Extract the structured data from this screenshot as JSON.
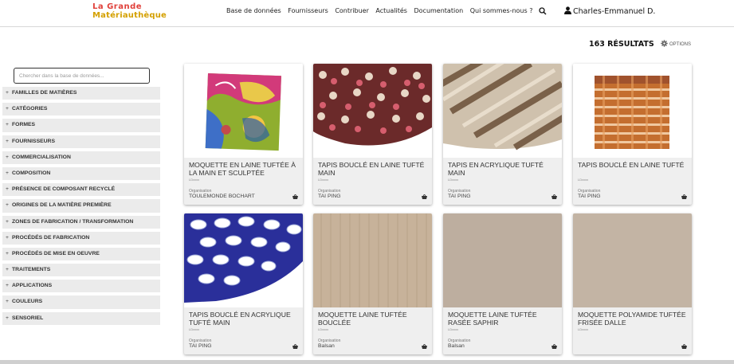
{
  "header": {
    "logo_line1": "La Grande",
    "logo_line2": "Matériauthèque",
    "nav": [
      "Base de données",
      "Fournisseurs",
      "Contribuer",
      "Actualités",
      "Documentation",
      "Qui sommes-nous ?"
    ],
    "user": "Charles-Emmanuel D."
  },
  "results": {
    "count_label": "163 RÉSULTATS",
    "options_label": "OPTIONS"
  },
  "sidebar": {
    "search_placeholder": "Chercher dans la base de données...",
    "filters": [
      "FAMILLES DE MATIÈRES",
      "CATÉGORIES",
      "FORMES",
      "FOURNISSEURS",
      "COMMERCIALISATION",
      "COMPOSITION",
      "PRÉSENCE DE COMPOSANT RECYCLÉ",
      "ORIGINES DE LA MATIÈRE PREMIÈRE",
      "ZONES DE FABRICATION / TRANSFORMATION",
      "PROCÉDÉS DE FABRICATION",
      "PROCÉDÉS DE MISE EN OEUVRE",
      "TRAITEMENTS",
      "APPLICATIONS",
      "COULEURS",
      "SENSORIEL"
    ]
  },
  "cards": [
    {
      "title": "MOQUETTE EN LAINE TUFTÉE À LA MAIN ET SCULPTÉE",
      "ref": "LDxxxx",
      "org_label": "Organisation",
      "org": "TOULEMONDE BOCHART",
      "image": "colorful-hand-tufted-rug"
    },
    {
      "title": "TAPIS BOUCLÉ EN LAINE TUFTÉ MAIN",
      "ref": "LDxxxx",
      "org_label": "Organisation",
      "org": "TAI PING",
      "image": "multicolor-loop-wool-carpet"
    },
    {
      "title": "TAPIS EN ACRYLIQUE TUFTÉ MAIN",
      "ref": "LDxxxx",
      "org_label": "Organisation",
      "org": "TAI PING",
      "image": "beige-brown-acrylic-carpet"
    },
    {
      "title": "TAPIS BOUCLÉ EN LAINE TUFTÉ",
      "ref": "LDxxxx",
      "org_label": "Organisation",
      "org": "TAI PING",
      "image": "orange-striped-loop-rug"
    },
    {
      "title": "TAPIS BOUCLÉ EN ACRYLIQUE TUFTÉ MAIN",
      "ref": "LDxxxx",
      "org_label": "Organisation",
      "org": "TAI PING",
      "image": "blue-white-loop-acrylic-carpet"
    },
    {
      "title": "MOQUETTE LAINE TUFTÉE BOUCLÉE",
      "ref": "LDxxxx",
      "org_label": "Organisation",
      "org": "Balsan",
      "image": "beige-wool-loop-carpet"
    },
    {
      "title": "MOQUETTE LAINE TUFTÉE RASÉE SAPHIR",
      "ref": "LDxxxx",
      "org_label": "Organisation",
      "org": "Balsan",
      "image": "taupe-cut-pile-carpet"
    },
    {
      "title": "MOQUETTE POLYAMIDE TUFTÉE FRISÉE DALLE",
      "ref": "LDxxxx",
      "org_label": "",
      "org": "",
      "image": "grey-beige-frieze-carpet-tile"
    }
  ],
  "colors": {
    "sidebar_bg": "#ebebeb",
    "card_bg": "#efefef",
    "accent": "#333333"
  },
  "icons": {
    "search": "search-icon",
    "user": "user-icon",
    "options": "gear-icon",
    "basket": "basket-icon"
  }
}
